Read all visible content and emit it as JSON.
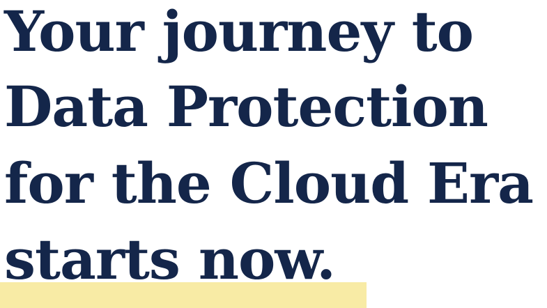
{
  "headline": {
    "line1": "Your journey to",
    "line2": "Data Protection",
    "line3": "for the Cloud Era",
    "line4": "starts now."
  },
  "colors": {
    "text": "#14264a",
    "highlight": "#f8eba5",
    "background": "#ffffff"
  }
}
